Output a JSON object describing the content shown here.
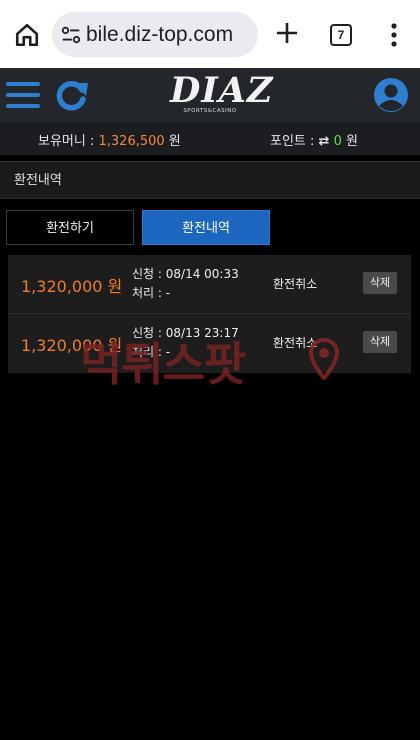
{
  "browser": {
    "url": "bile.diz-top.com",
    "tab_count": "7"
  },
  "header": {
    "logo_text": "DIAZ",
    "logo_subtext": "SPORTS&CASINO"
  },
  "balance": {
    "money_label": "보유머니 : ",
    "money_value": "1,326,500",
    "money_unit": " 원",
    "points_label": "포인트 : ",
    "points_swap": "⇄",
    "points_value": "0",
    "points_unit": " 원"
  },
  "section_title": "환전내역",
  "tabs": [
    {
      "label": "환전하기",
      "active": false
    },
    {
      "label": "환전내역",
      "active": true
    }
  ],
  "records": [
    {
      "amount": "1,320,000 원",
      "request": "신청 : 08/14 00:33",
      "process": "처리 : -",
      "status": "환전취소",
      "delete_label": "삭제"
    },
    {
      "amount": "1,320,000 원",
      "request": "신청 : 08/13 23:17",
      "process": "처리 : -",
      "status": "환전취소",
      "delete_label": "삭제"
    }
  ],
  "watermark": {
    "text": "먹튀스팟"
  },
  "colors": {
    "accent_orange": "#f07d2a",
    "points_green": "#5fdc4e",
    "active_tab_blue": "#1d66bf",
    "icon_blue": "#2f7fd1"
  }
}
